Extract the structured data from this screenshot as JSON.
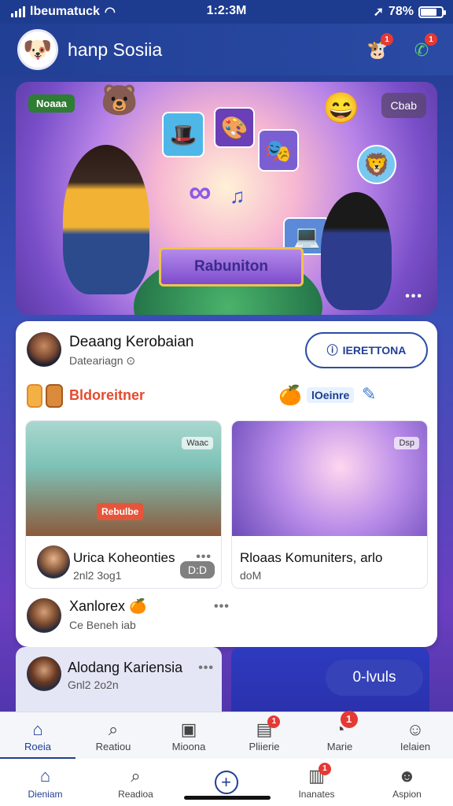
{
  "status_bar": {
    "carrier": "lbeumatuck",
    "time": "1:2:3M",
    "battery_text": "78%",
    "battery_level": 0.78
  },
  "header": {
    "avatar_icon": "cartoon-dog-icon",
    "title": "hanp Sosiia",
    "actions": [
      {
        "icon": "mascot-icon",
        "badge": "1"
      },
      {
        "icon": "phone-icon",
        "badge": "1"
      }
    ]
  },
  "hero": {
    "chip": "Noaaa",
    "corner_button": "Cbab",
    "box_label": "Rabuniton",
    "more": "•••"
  },
  "main_card": {
    "profile": {
      "name": "Deaang Kerobaian",
      "sub": "Dateariagn ⊙"
    },
    "register_button": {
      "icon": "info-icon",
      "label": "IERETTONA"
    },
    "section": {
      "label": "Bldoreitner",
      "tag": "lOeinre"
    },
    "cards": [
      {
        "thumb_chip": "Waac",
        "thumb_label": "Rebulbe",
        "duration": "D:D",
        "title": "Urica Koheonties",
        "sub": "2nl2 3og1",
        "more": "•••"
      },
      {
        "thumb_chip": "Dsp",
        "thumb_label": "",
        "duration": "",
        "title": "Rloaas Komuniters, arlo",
        "sub": "doM",
        "more": ""
      }
    ],
    "bottom_item": {
      "title": "Xanlorex",
      "sub": "Ce Beneh iab",
      "more": "•••"
    }
  },
  "lower": {
    "left": {
      "title": "Alodang Kariensia",
      "sub": "Gnl2 2o2n",
      "more": "•••"
    },
    "right": {
      "pill": "0-lvuls"
    }
  },
  "tabbar_top": [
    {
      "icon": "home-icon",
      "label": "Roeia",
      "active": true,
      "badge": ""
    },
    {
      "icon": "search-icon",
      "label": "Reatiou",
      "active": false,
      "badge": ""
    },
    {
      "icon": "media-icon",
      "label": "Mioona",
      "active": false,
      "badge": ""
    },
    {
      "icon": "document-icon",
      "label": "Pliierie",
      "active": false,
      "badge": "1"
    },
    {
      "icon": "chat-icon",
      "label": "Marie",
      "active": false,
      "badge": "1"
    },
    {
      "icon": "profile-icon",
      "label": "Ielaien",
      "active": false,
      "badge": ""
    }
  ],
  "tabbar_bottom": [
    {
      "icon": "home-icon",
      "label": "Dieniam",
      "active": true
    },
    {
      "icon": "search-icon",
      "label": "Readioa",
      "active": false
    },
    {
      "icon": "plus-icon",
      "label": "",
      "active": false
    },
    {
      "icon": "notes-icon",
      "label": "Inanates",
      "active": false,
      "badge": "1"
    },
    {
      "icon": "user-icon",
      "label": "Aspion",
      "active": false
    }
  ],
  "colors": {
    "brand": "#213f94",
    "accent_red": "#e53935",
    "section_label": "#e64a2e"
  }
}
